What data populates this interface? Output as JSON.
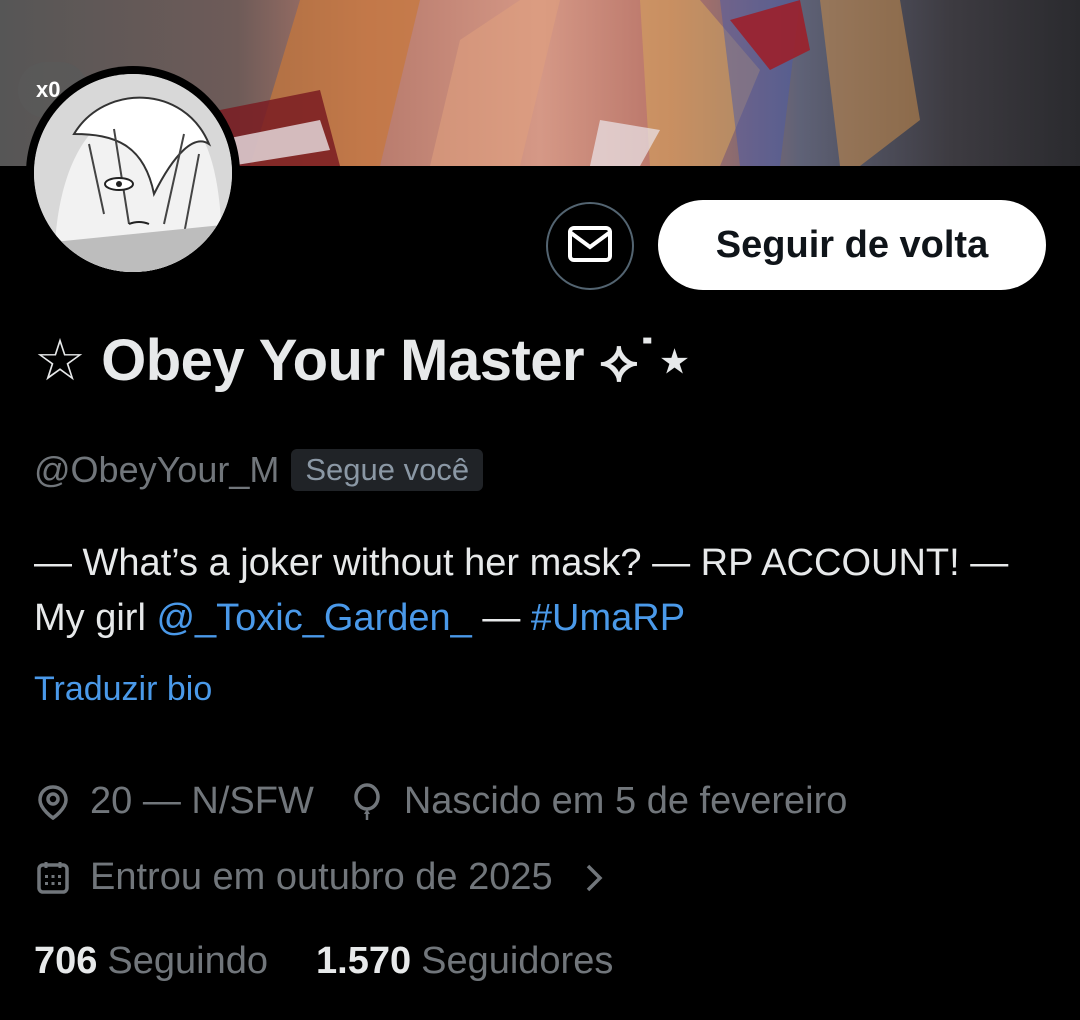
{
  "banner": {
    "back_label": "x0"
  },
  "actions": {
    "message_icon": "mail-icon",
    "follow_back_label": "Seguir de volta"
  },
  "profile": {
    "display_name": "☆ Obey Your Master ⟡˙⋆",
    "handle": "@ObeyYour_M",
    "follows_you_badge": "Segue você",
    "bio": {
      "part1": "— What’s a joker without her mask? — RP ACCOUNT! — My girl ",
      "mention": "@_Toxic_Garden_",
      "part2": " — ",
      "hashtag": "#UmaRP"
    },
    "translate_label": "Traduzir bio",
    "location": "20 — N/SFW",
    "birthday": "Nascido em 5 de fevereiro",
    "joined": "Entrou em outubro de 2025",
    "following_count": "706",
    "following_label": "Seguindo",
    "followers_count": "1.570",
    "followers_label": "Seguidores"
  },
  "colors": {
    "background": "#000000",
    "link": "#4a99e9",
    "muted": "#71767b",
    "text": "#e7e9ea"
  }
}
